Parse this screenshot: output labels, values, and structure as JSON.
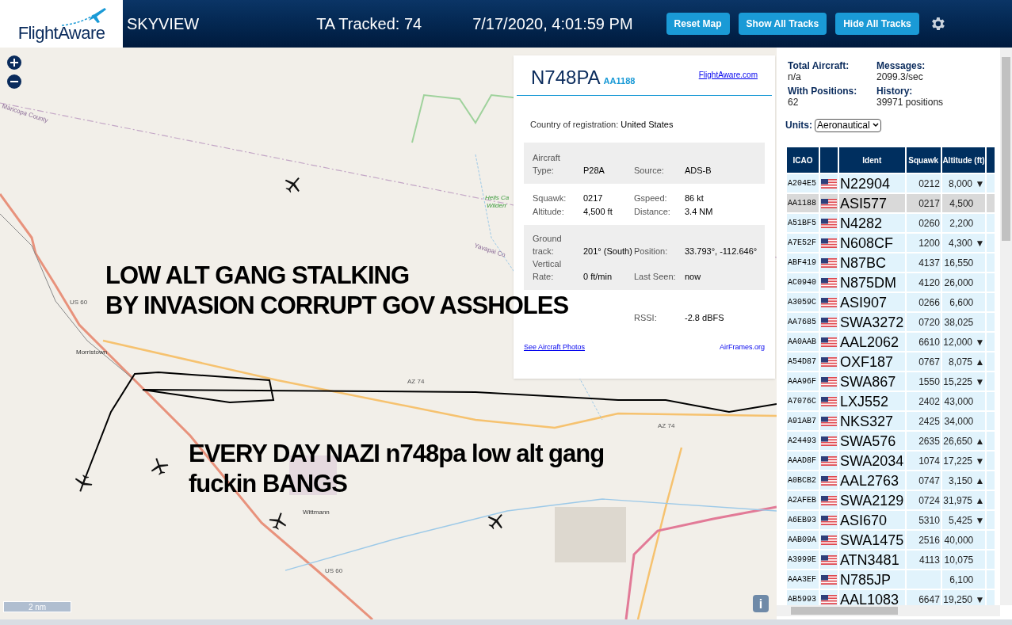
{
  "header": {
    "logo": "FlightAware",
    "title": "SKYVIEW",
    "tracked": "TA Tracked: 74",
    "datetime": "7/17/2020, 4:01:59 PM",
    "buttons": [
      "Reset Map",
      "Show All Tracks",
      "Hide All Tracks"
    ]
  },
  "map": {
    "labels": [
      "Maricopa County",
      "Hells Ca",
      "Wilderr",
      "Yavapai Co",
      "US 60",
      "Morristown",
      "AZ 74",
      "AZ 74",
      "Wittmann",
      "US 60"
    ],
    "scale": "2 nm",
    "info": "i"
  },
  "popup": {
    "ident": "N748PA",
    "callsign": "AA1188",
    "link": "FlightAware.com",
    "country_label": "Country of registration:",
    "country": "United States",
    "sections": [
      {
        "shaded": true,
        "fields": [
          {
            "label": "Aircraft Type:",
            "value": "P28A"
          },
          {
            "label": "Source:",
            "value": "ADS-B"
          }
        ]
      },
      {
        "shaded": false,
        "fields": [
          {
            "label": "Squawk:",
            "value": "0217"
          },
          {
            "label": "Gspeed:",
            "value": "86 kt"
          },
          {
            "label": "Altitude:",
            "value": "4,500 ft"
          },
          {
            "label": "Distance:",
            "value": "3.4 NM"
          }
        ]
      },
      {
        "shaded": true,
        "fields": [
          {
            "label": "Ground track:",
            "value": "201° (South)"
          },
          {
            "label": "Position:",
            "value": "33.793°, -112.646°"
          },
          {
            "label": "Vertical Rate:",
            "value": "0 ft/min"
          },
          {
            "label": "Last Seen:",
            "value": "now"
          }
        ]
      },
      {
        "shaded": false,
        "fields": [
          {
            "label": "RSSI:",
            "value": "-2.8 dBFS"
          }
        ]
      }
    ],
    "footer_links": [
      "See Aircraft Photos",
      "AirFrames.org"
    ]
  },
  "annotations": [
    {
      "lines": [
        "LOW ALT GANG STALKING",
        "BY INVASION CORRUPT GOV ASSHOLES"
      ]
    },
    {
      "lines": [
        "EVERY DAY NAZI n748pa low alt gang",
        "fuckin BANGS"
      ]
    }
  ],
  "stats": [
    {
      "label": "Total Aircraft:",
      "value": "n/a"
    },
    {
      "label": "Messages:",
      "value": "2099.3/sec"
    },
    {
      "label": "With Positions:",
      "value": "62"
    },
    {
      "label": "History:",
      "value": "39971 positions"
    }
  ],
  "units": {
    "label": "Units:",
    "value": "Aeronautical"
  },
  "table": {
    "columns": [
      "ICAO",
      "",
      "Ident",
      "Squawk",
      "Altitude (ft)"
    ],
    "rows": [
      {
        "icao": "A204E5",
        "ident": "N22904",
        "squawk": "0212",
        "altitude": "8,000",
        "trend": "▼",
        "selected": false
      },
      {
        "icao": "AA1188",
        "ident": "ASI577",
        "squawk": "0217",
        "altitude": "4,500",
        "trend": "",
        "selected": true
      },
      {
        "icao": "A51BF5",
        "ident": "N4282",
        "squawk": "0260",
        "altitude": "2,200",
        "trend": "",
        "selected": false
      },
      {
        "icao": "A7E52F",
        "ident": "N608CF",
        "squawk": "1200",
        "altitude": "4,300",
        "trend": "▼",
        "selected": false
      },
      {
        "icao": "ABF419",
        "ident": "N87BC",
        "squawk": "4137",
        "altitude": "16,550",
        "trend": "",
        "selected": false
      },
      {
        "icao": "AC0940",
        "ident": "N875DM",
        "squawk": "4120",
        "altitude": "26,000",
        "trend": "",
        "selected": false
      },
      {
        "icao": "A3059C",
        "ident": "ASI907",
        "squawk": "0266",
        "altitude": "6,600",
        "trend": "",
        "selected": false
      },
      {
        "icao": "AA7685",
        "ident": "SWA3272",
        "squawk": "0720",
        "altitude": "38,025",
        "trend": "",
        "selected": false
      },
      {
        "icao": "AA0AAB",
        "ident": "AAL2062",
        "squawk": "6610",
        "altitude": "12,000",
        "trend": "▼",
        "selected": false
      },
      {
        "icao": "A54D87",
        "ident": "OXF187",
        "squawk": "0767",
        "altitude": "8,075",
        "trend": "▲",
        "selected": false
      },
      {
        "icao": "AAA96F",
        "ident": "SWA867",
        "squawk": "1550",
        "altitude": "15,225",
        "trend": "▼",
        "selected": false
      },
      {
        "icao": "A7076C",
        "ident": "LXJ552",
        "squawk": "2402",
        "altitude": "43,000",
        "trend": "",
        "selected": false
      },
      {
        "icao": "A91AB7",
        "ident": "NKS327",
        "squawk": "2425",
        "altitude": "34,000",
        "trend": "",
        "selected": false
      },
      {
        "icao": "A24493",
        "ident": "SWA576",
        "squawk": "2635",
        "altitude": "26,650",
        "trend": "▲",
        "selected": false
      },
      {
        "icao": "AAAD8F",
        "ident": "SWA2034",
        "squawk": "1074",
        "altitude": "17,225",
        "trend": "▼",
        "selected": false
      },
      {
        "icao": "A0BCB2",
        "ident": "AAL2763",
        "squawk": "0747",
        "altitude": "3,150",
        "trend": "▲",
        "selected": false
      },
      {
        "icao": "A2AFEB",
        "ident": "SWA2129",
        "squawk": "0724",
        "altitude": "31,975",
        "trend": "▲",
        "selected": false
      },
      {
        "icao": "A6EB93",
        "ident": "ASI670",
        "squawk": "5310",
        "altitude": "5,425",
        "trend": "▼",
        "selected": false
      },
      {
        "icao": "AAB09A",
        "ident": "SWA1475",
        "squawk": "2516",
        "altitude": "40,000",
        "trend": "",
        "selected": false
      },
      {
        "icao": "A3999E",
        "ident": "ATN3481",
        "squawk": "4113",
        "altitude": "10,075",
        "trend": "",
        "selected": false
      },
      {
        "icao": "AAA3EF",
        "ident": "N785JP",
        "squawk": "",
        "altitude": "6,100",
        "trend": "",
        "selected": false
      },
      {
        "icao": "AB5993",
        "ident": "AAL1083",
        "squawk": "6647",
        "altitude": "19,250",
        "trend": "▼",
        "selected": false
      }
    ]
  }
}
